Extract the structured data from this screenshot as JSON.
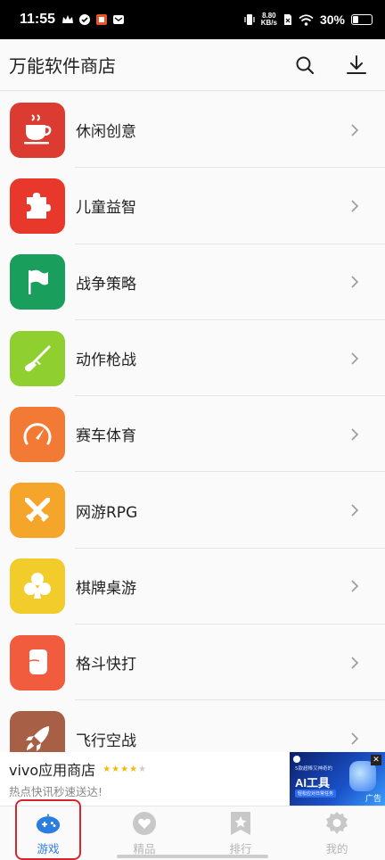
{
  "status_bar": {
    "time": "11:55",
    "net_speed_value": "8.80",
    "net_speed_unit": "KB/s",
    "battery": "30%",
    "battery_level": 0.3
  },
  "header": {
    "title": "万能软件商店",
    "search_icon": "search-icon",
    "download_icon": "download-icon"
  },
  "categories": [
    {
      "label": "休闲创意",
      "icon": "coffee-cup-icon",
      "color": "#db3b30"
    },
    {
      "label": "儿童益智",
      "icon": "puzzle-icon",
      "color": "#e8382b"
    },
    {
      "label": "战争策略",
      "icon": "flag-icon",
      "color": "#1a9e5c"
    },
    {
      "label": "动作枪战",
      "icon": "rifle-icon",
      "color": "#8fcf2f"
    },
    {
      "label": "赛车体育",
      "icon": "speedometer-icon",
      "color": "#f27a34"
    },
    {
      "label": "网游RPG",
      "icon": "crossed-swords-icon",
      "color": "#f5a52a"
    },
    {
      "label": "棋牌桌游",
      "icon": "club-card-icon",
      "color": "#f2cc2a"
    },
    {
      "label": "格斗快打",
      "icon": "fist-icon",
      "color": "#f15b3e"
    },
    {
      "label": "飞行空战",
      "icon": "rocket-icon",
      "color": "#a75f45"
    }
  ],
  "ad": {
    "title": "vivo应用商店",
    "subtitle": "热点快讯秒速送达!",
    "rating": 4,
    "image_line1": "5款超棒又神奇的",
    "image_line2": "AI工具",
    "image_line3": "轻松应对日常任务",
    "close": "✕",
    "ad_mark": "广告"
  },
  "tabs": [
    {
      "label": "游戏",
      "icon": "gamepad-icon",
      "active": true
    },
    {
      "label": "精品",
      "icon": "heart-icon",
      "active": false
    },
    {
      "label": "排行",
      "icon": "ranking-star-icon",
      "active": false
    },
    {
      "label": "我的",
      "icon": "gear-icon",
      "active": false
    }
  ],
  "colors": {
    "accent": "#2a7de1",
    "inactive": "#c0c0c0",
    "highlight": "#d8262d"
  }
}
